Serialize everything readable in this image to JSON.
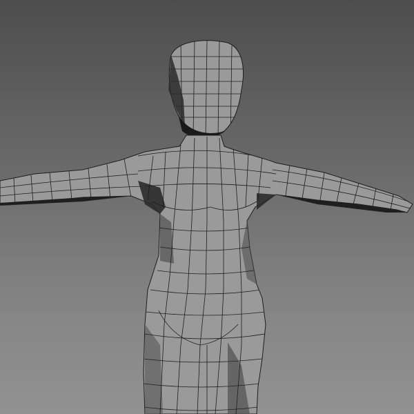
{
  "viewport": {
    "background_top": "#4d4d4d",
    "background_bottom": "#929292",
    "mesh_fill": "#9a9a9a",
    "mesh_shadow": "#2a2a2a",
    "wire_color": "#1c1c1c",
    "display_mode": "wireframe-on-shaded",
    "pose": "T-pose"
  }
}
